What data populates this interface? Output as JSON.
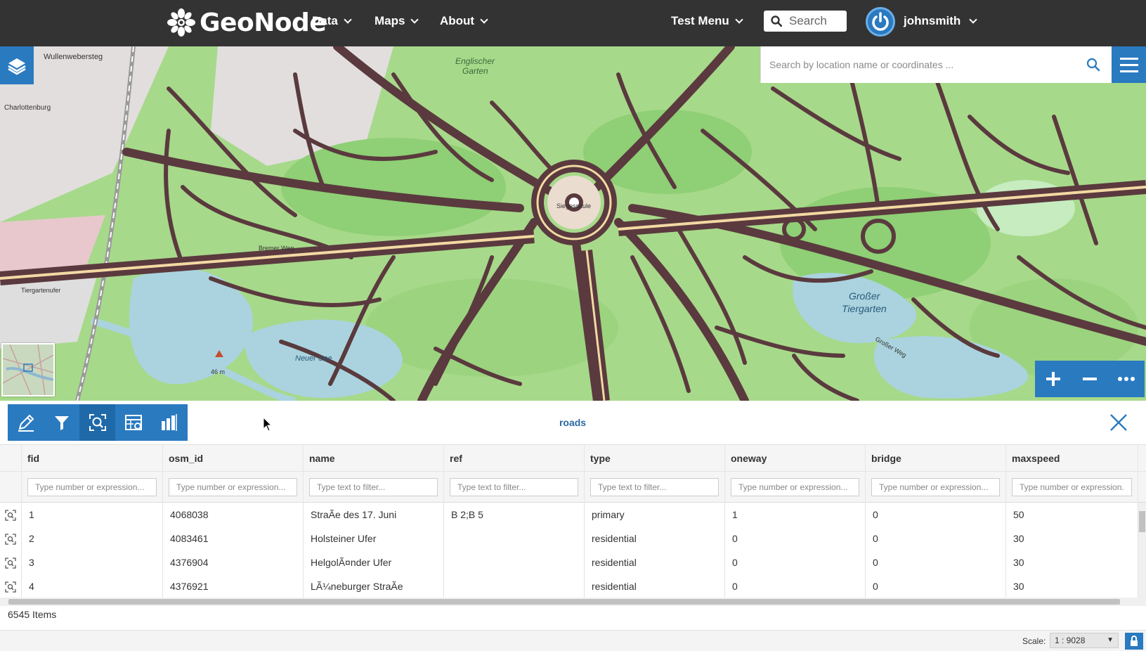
{
  "navbar": {
    "brand": "GeoNode",
    "menus": [
      "Data",
      "Maps",
      "About"
    ],
    "test_menu": "Test Menu",
    "search_placeholder": "Search",
    "username": "johnsmith"
  },
  "map": {
    "location_search_placeholder": "Search by location name or coordinates ...",
    "labels": {
      "wullenwebersteg": "Wullenwebersteg",
      "englischer": "Englischer",
      "garten": "Garten",
      "charlottenburg": "Charlottenburg",
      "siegessaule": "Siegessäule",
      "bremer_weg": "Bremer Weg",
      "tiergartenufer": "Tiergartenufer",
      "neuer_see": "Neuer See",
      "height": "46 m",
      "grosser": "Großer",
      "tiergarten": "Tiergarten",
      "grosser_weg": "Großer Weg"
    },
    "colors": {
      "park": "#a7d98a",
      "road": "#5a3a3e",
      "water": "#aad3df",
      "urban": "#e0dfdf",
      "main_road": "#f2d9a3"
    }
  },
  "table": {
    "layer_name": "roads",
    "columns": [
      {
        "key": "fid",
        "label": "fid",
        "placeholder": "Type number or expression..."
      },
      {
        "key": "osm_id",
        "label": "osm_id",
        "placeholder": "Type number or expression..."
      },
      {
        "key": "name",
        "label": "name",
        "placeholder": "Type text to filter..."
      },
      {
        "key": "ref",
        "label": "ref",
        "placeholder": "Type text to filter..."
      },
      {
        "key": "type",
        "label": "type",
        "placeholder": "Type text to filter..."
      },
      {
        "key": "oneway",
        "label": "oneway",
        "placeholder": "Type number or expression..."
      },
      {
        "key": "bridge",
        "label": "bridge",
        "placeholder": "Type number or expression..."
      },
      {
        "key": "maxspeed",
        "label": "maxspeed",
        "placeholder": "Type number or expression..."
      }
    ],
    "rows": [
      [
        "1",
        "4068038",
        "StraÃe des 17. Juni",
        "B 2;B 5",
        "primary",
        "1",
        "0",
        "50"
      ],
      [
        "2",
        "4083461",
        "Holsteiner Ufer",
        "",
        "residential",
        "0",
        "0",
        "30"
      ],
      [
        "3",
        "4376904",
        "HelgolÃ¤nder Ufer",
        "",
        "residential",
        "0",
        "0",
        "30"
      ],
      [
        "4",
        "4376921",
        "LÃ¼neburger StraÃe",
        "",
        "residential",
        "0",
        "0",
        "30"
      ]
    ],
    "item_count": "6545 Items"
  },
  "status": {
    "scale_label": "Scale:",
    "scale_value": "1 : 9028"
  },
  "accent_color": "#2a7ac0"
}
